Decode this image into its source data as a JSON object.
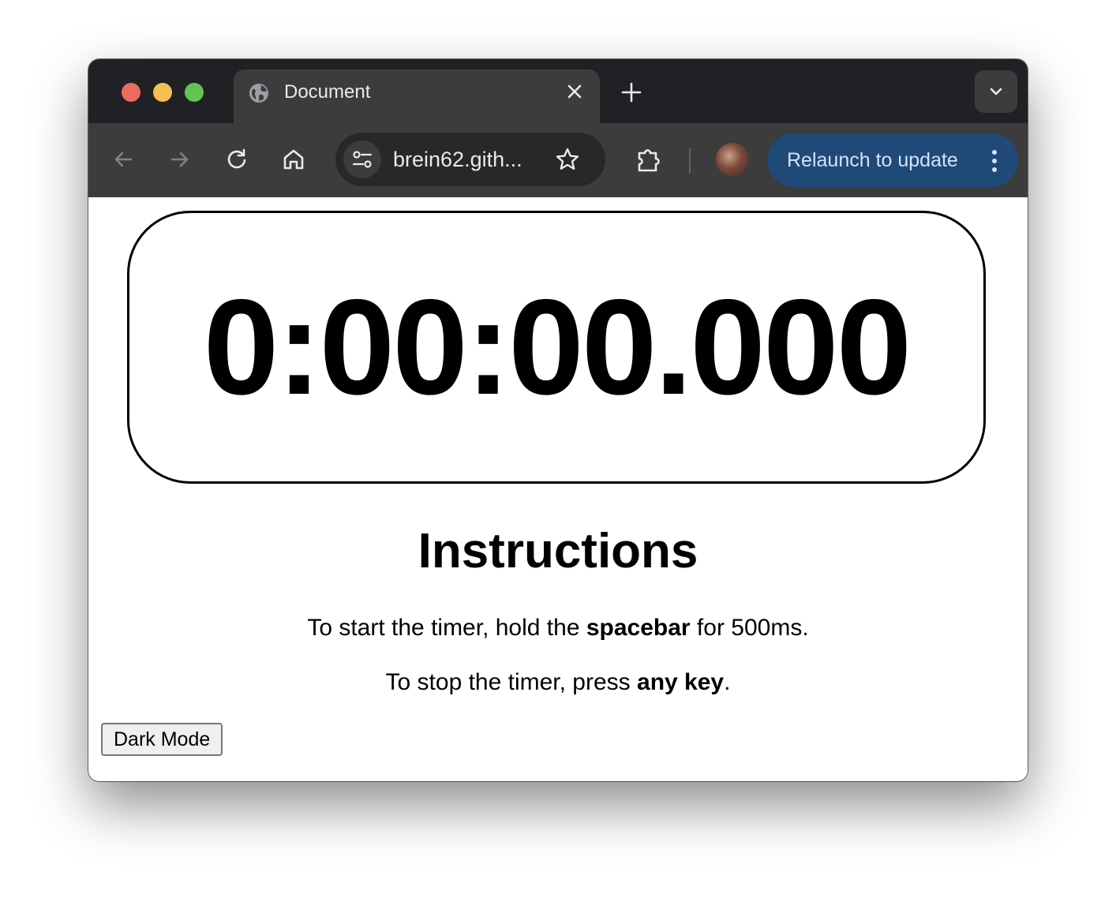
{
  "browser": {
    "tab": {
      "title": "Document"
    },
    "address_bar": {
      "url": "brein62.gith..."
    },
    "relaunch_label": "Relaunch to update"
  },
  "page": {
    "timer": "0:00:00.000",
    "instructions": {
      "title": "Instructions",
      "line1": {
        "before": "To start the timer, hold the ",
        "bold": "spacebar",
        "after": " for 500ms."
      },
      "line2": {
        "before": "To stop the timer, press ",
        "bold": "any key",
        "after": "."
      }
    },
    "dark_mode_button": "Dark Mode"
  },
  "icons": {
    "tab": "globe-icon",
    "close": "close-icon",
    "new_tab": "plus-icon",
    "tab_search": "chevron-down-icon",
    "back": "arrow-left-icon",
    "forward": "arrow-right-icon",
    "reload": "reload-icon",
    "home": "home-icon",
    "site_info": "tune-icon",
    "bookmark": "star-icon",
    "extensions": "puzzle-icon",
    "menu": "kebab-icon"
  },
  "colors": {
    "tabstrip": "#202124",
    "toolbar": "#3c3c3c",
    "relaunch_bg": "#1f4a78",
    "relaunch_text": "#d2e3fc"
  }
}
